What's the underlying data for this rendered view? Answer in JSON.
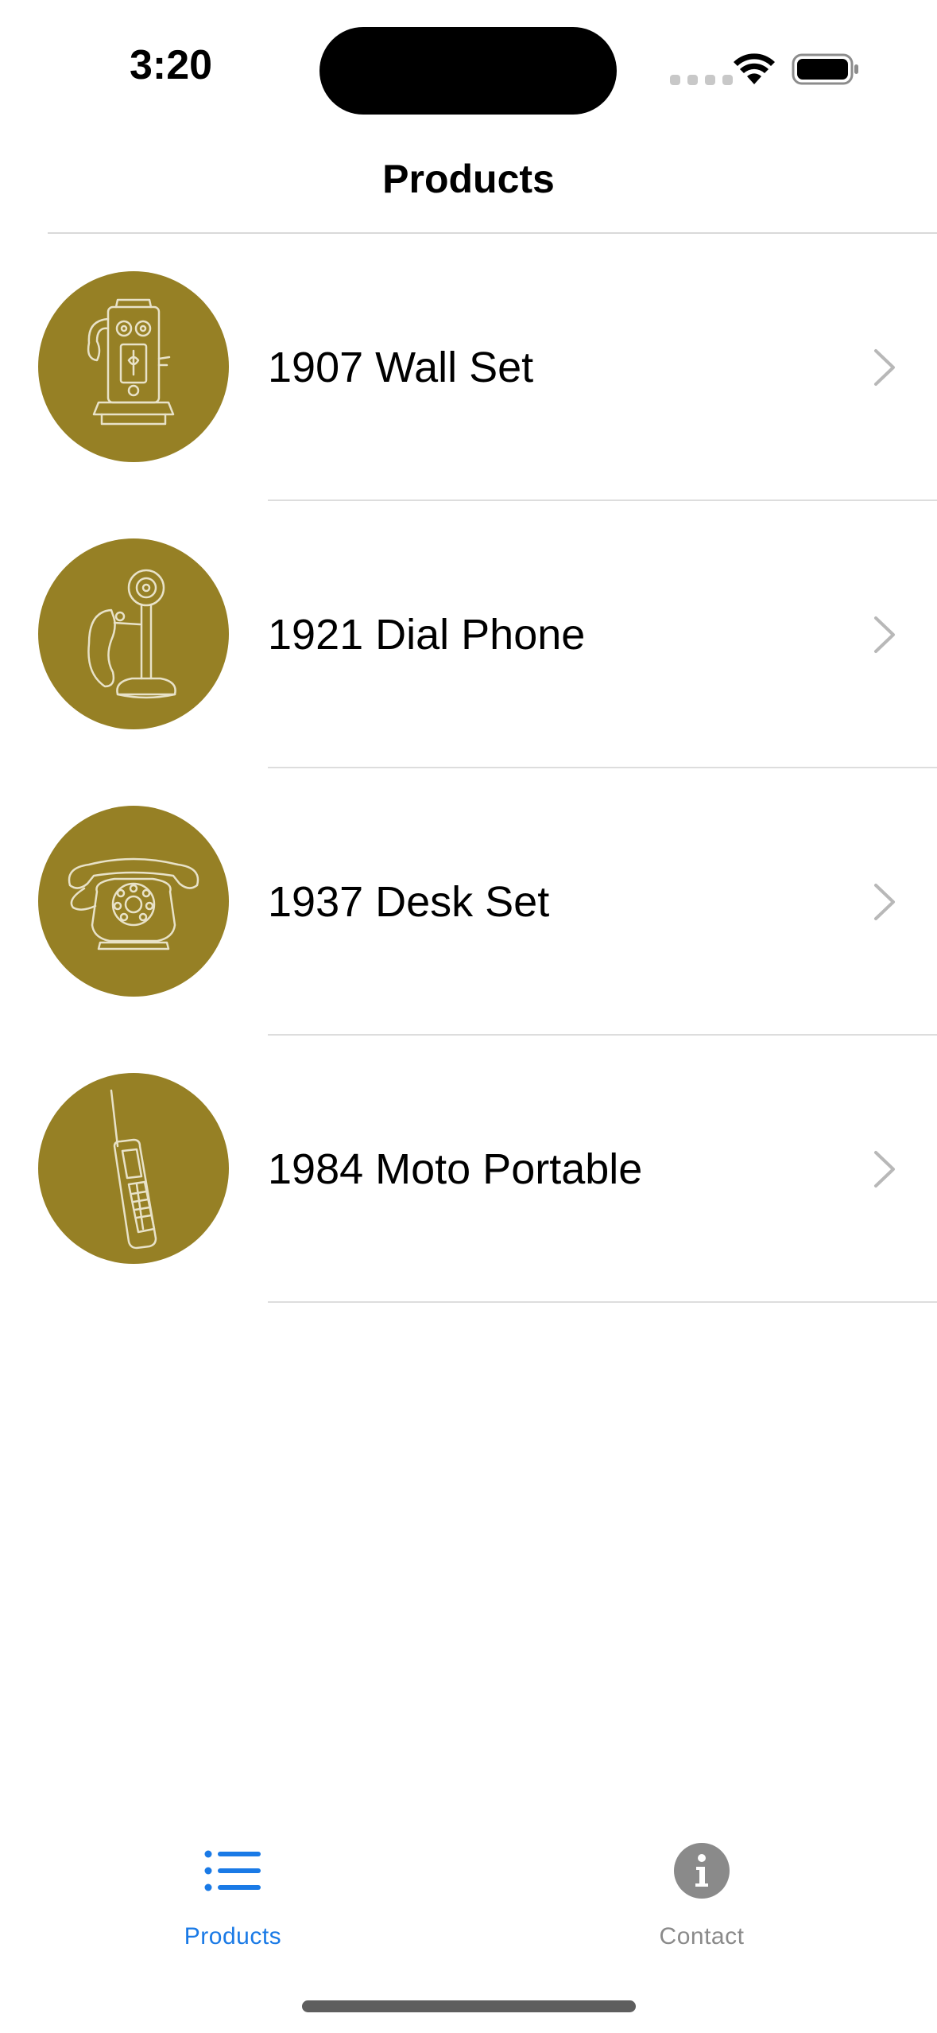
{
  "status_bar": {
    "time": "3:20"
  },
  "nav": {
    "title": "Products"
  },
  "products": [
    {
      "title": "1907 Wall Set",
      "icon": "wall-telephone-icon"
    },
    {
      "title": "1921 Dial Phone",
      "icon": "candlestick-phone-icon"
    },
    {
      "title": "1937 Desk Set",
      "icon": "rotary-desk-phone-icon"
    },
    {
      "title": "1984 Moto Portable",
      "icon": "brick-cellphone-icon"
    }
  ],
  "tab_bar": {
    "tabs": [
      {
        "label": "Products",
        "icon": "list-icon",
        "selected": true
      },
      {
        "label": "Contact",
        "icon": "info-icon",
        "selected": false
      }
    ]
  },
  "colors": {
    "thumbnail_bg": "#968025",
    "accent": "#1a7ae6",
    "inactive_tab": "#8a8a8a",
    "chevron": "#b8b8b8"
  }
}
